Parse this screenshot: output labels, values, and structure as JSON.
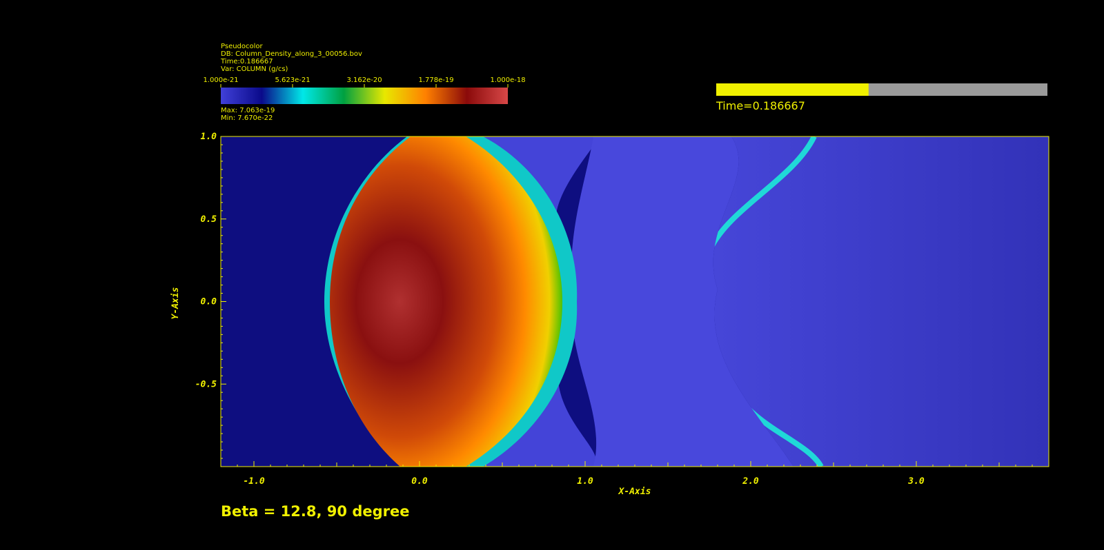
{
  "legend": {
    "plot_type": "Pseudocolor",
    "db": "DB: Column_Density_along_3_00056.bov",
    "time": "Time:0.186667",
    "var": "Var: COLUMN (g/cs)",
    "max_label": "Max:  7.063e-19",
    "min_label": "Min:  7.670e-22"
  },
  "colorbar": {
    "tick_labels": [
      "1.000e-21",
      "5.623e-21",
      "3.162e-20",
      "1.778e-19",
      "1.000e-18"
    ],
    "colors": [
      "#4040d8",
      "#0a0a8a",
      "#00e8e8",
      "#00a040",
      "#e8e800",
      "#ff8000",
      "#8a0a0a",
      "#d84848"
    ]
  },
  "time_bar": {
    "label": "Time=0.186667",
    "progress": 0.46,
    "fill_color": "#f0f000",
    "track_color": "#9a9a9a"
  },
  "chart_data": {
    "type": "heatmap",
    "xlabel": "X-Axis",
    "ylabel": "Y-Axis",
    "xlim": [
      -1.2,
      3.8
    ],
    "ylim": [
      -1.0,
      1.0
    ],
    "x_ticks": [
      -1.0,
      0.0,
      1.0,
      2.0,
      3.0
    ],
    "x_tick_labels": [
      "-1.0",
      "0.0",
      "1.0",
      "2.0",
      "3.0"
    ],
    "y_ticks": [
      1.0,
      0.5,
      0.0,
      -0.5
    ],
    "y_tick_labels": [
      "1.0",
      "0.5",
      "0.0",
      "-0.5"
    ],
    "background_colors": [
      "#0e0e80",
      "#3c3ccc"
    ]
  },
  "caption": "Beta = 12.8, 90 degree",
  "colors": {
    "foreground": "#f0f000",
    "background": "#000000"
  }
}
